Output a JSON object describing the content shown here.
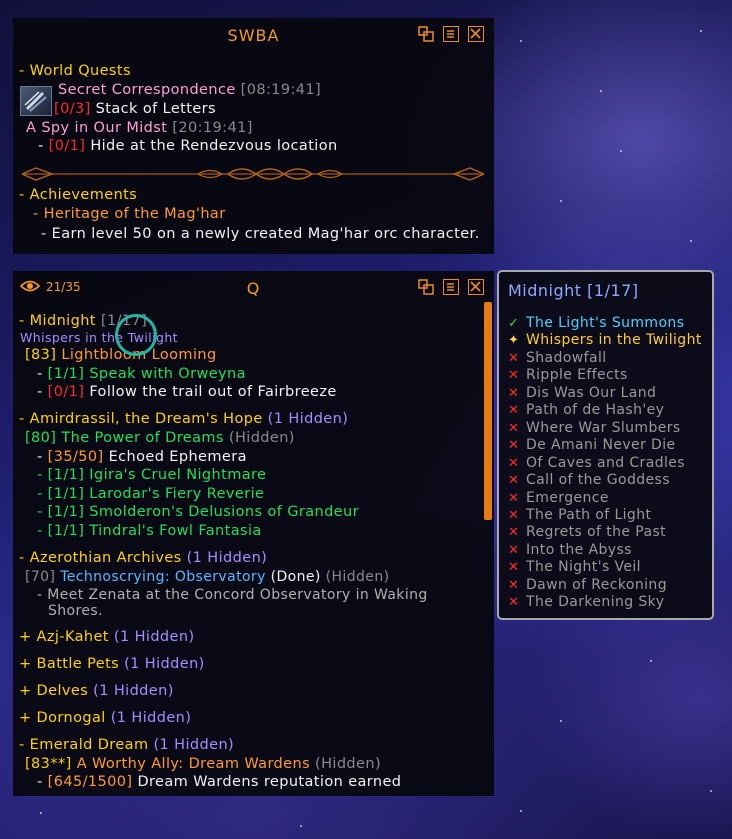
{
  "top_panel": {
    "title": "SWBA",
    "world_quests": {
      "header": "- World Quests",
      "quest1_name": "Secret Correspondence",
      "quest1_time": "[08:19:41]",
      "quest1_obj_count": "0/3]",
      "quest1_obj_open": "",
      "quest1_obj_text": "Stack of Letters",
      "quest2_name": "A Spy in Our Midst",
      "quest2_time": "[20:19:41]",
      "quest2_obj_dash": "-",
      "quest2_obj_count": "[0/1]",
      "quest2_obj_text": "Hide at the Rendezvous location"
    },
    "achievements": {
      "header": "- Achievements",
      "item": "- Heritage of the Mag'har",
      "desc": "- Earn level 50 on a newly created Mag'har orc character."
    }
  },
  "quest_panel": {
    "title": "Q",
    "count": "21/35",
    "lines": [
      {
        "name": "zone-midnight",
        "parts": [
          [
            "- Midnight",
            "y"
          ],
          [
            " [1/17]",
            "gy"
          ]
        ]
      },
      {
        "name": "campaign-label",
        "parts": [
          [
            "Whispers in the Twilight",
            "pu"
          ]
        ]
      },
      {
        "name": "quest-lightbloom",
        "parts": [
          [
            "[83] ",
            "y"
          ],
          [
            "Lightbloom Looming",
            "o"
          ]
        ]
      },
      {
        "name": "obj-speak",
        "parts": [
          [
            "- ",
            "w"
          ],
          [
            "[1/1] Speak with Orweyna",
            "g"
          ]
        ]
      },
      {
        "name": "obj-follow",
        "parts": [
          [
            "- ",
            "w"
          ],
          [
            "[0/1]",
            "r"
          ],
          [
            " Follow the trail out of Fairbreeze",
            "w"
          ]
        ]
      },
      {
        "name": "zone-amirdrassil",
        "parts": [
          [
            "- Amirdrassil, the Dream's Hope",
            "y"
          ],
          [
            " (1 Hidden)",
            "pu"
          ]
        ]
      },
      {
        "name": "quest-power-of-dreams",
        "parts": [
          [
            "[80] The Power of Dreams",
            "g"
          ],
          [
            " (Hidden)",
            "gy"
          ]
        ]
      },
      {
        "name": "obj-echoed",
        "parts": [
          [
            "- ",
            "w"
          ],
          [
            "[35/50]",
            "o"
          ],
          [
            " Echoed Ephemera",
            "w"
          ]
        ]
      },
      {
        "name": "obj-igira",
        "parts": [
          [
            "- [1/1] Igira's Cruel Nightmare",
            "g"
          ]
        ]
      },
      {
        "name": "obj-larodar",
        "parts": [
          [
            "- [1/1] Larodar's Fiery Reverie",
            "g"
          ]
        ]
      },
      {
        "name": "obj-smolderon",
        "parts": [
          [
            "- [1/1] Smolderon's Delusions of Grandeur",
            "g"
          ]
        ]
      },
      {
        "name": "obj-tindral",
        "parts": [
          [
            "- [1/1] Tindral's Fowl Fantasia",
            "g"
          ]
        ]
      },
      {
        "name": "zone-azerothian",
        "parts": [
          [
            "- Azerothian Archives",
            "y"
          ],
          [
            " (1 Hidden)",
            "pu"
          ]
        ]
      },
      {
        "name": "quest-technoscrying",
        "parts": [
          [
            "[70] ",
            "gy"
          ],
          [
            "Technoscrying: Observatory",
            "cy"
          ],
          [
            " (Done)",
            "w"
          ],
          [
            " (Hidden)",
            "gy"
          ]
        ]
      },
      {
        "name": "obj-zenata",
        "parts": [
          [
            "- Meet Zenata at the Concord Observatory in Waking",
            "lg"
          ]
        ]
      },
      {
        "name": "obj-zenata-2",
        "parts": [
          [
            "Shores.",
            "lg"
          ]
        ]
      },
      {
        "name": "zone-azj-kahet",
        "parts": [
          [
            "+ Azj-Kahet",
            "y"
          ],
          [
            " (1 Hidden)",
            "pu"
          ]
        ]
      },
      {
        "name": "zone-battle-pets",
        "parts": [
          [
            "+ Battle Pets",
            "y"
          ],
          [
            " (1 Hidden)",
            "pu"
          ]
        ]
      },
      {
        "name": "zone-delves",
        "parts": [
          [
            "+ Delves",
            "y"
          ],
          [
            " (1 Hidden)",
            "pu"
          ]
        ]
      },
      {
        "name": "zone-dornogal",
        "parts": [
          [
            "+ Dornogal",
            "y"
          ],
          [
            " (1 Hidden)",
            "pu"
          ]
        ]
      },
      {
        "name": "zone-emerald-dream",
        "parts": [
          [
            "- Emerald Dream",
            "y"
          ],
          [
            " (1 Hidden)",
            "pu"
          ]
        ]
      },
      {
        "name": "quest-worthy-ally",
        "parts": [
          [
            "[83**] ",
            "y"
          ],
          [
            "A Worthy Ally: Dream Wardens",
            "o"
          ],
          [
            " (Hidden)",
            "gy"
          ]
        ]
      },
      {
        "name": "obj-dream-wardens",
        "parts": [
          [
            "- ",
            "w"
          ],
          [
            "[645/1500]",
            "o"
          ],
          [
            " Dream Wardens reputation earned",
            "w"
          ]
        ]
      }
    ]
  },
  "tooltip": {
    "title": "Midnight [1/17]",
    "items": [
      {
        "label": "The Light's Summons",
        "state": "done"
      },
      {
        "label": "Whispers in the Twilight",
        "state": "current"
      },
      {
        "label": "Shadowfall",
        "state": "todo"
      },
      {
        "label": "Ripple Effects",
        "state": "todo"
      },
      {
        "label": "Dis Was Our Land",
        "state": "todo"
      },
      {
        "label": "Path of de Hash'ey",
        "state": "todo"
      },
      {
        "label": "Where War Slumbers",
        "state": "todo"
      },
      {
        "label": "De Amani Never Die",
        "state": "todo"
      },
      {
        "label": "Of Caves and Cradles",
        "state": "todo"
      },
      {
        "label": "Call of the Goddess",
        "state": "todo"
      },
      {
        "label": "Emergence",
        "state": "todo"
      },
      {
        "label": "The Path of Light",
        "state": "todo"
      },
      {
        "label": "Regrets of the Past",
        "state": "todo"
      },
      {
        "label": "Into the Abyss",
        "state": "todo"
      },
      {
        "label": "The Night's Veil",
        "state": "todo"
      },
      {
        "label": "Dawn of Reckoning",
        "state": "todo"
      },
      {
        "label": "The Darkening Sky",
        "state": "todo"
      }
    ]
  },
  "colors": {
    "accent_orange": "#f39a2b",
    "zone_yellow": "#ffd200",
    "complete_green": "#1fe05a",
    "incomplete_red": "#ff2a2a",
    "hidden_purple": "#a78bff"
  },
  "icons": [
    "toggle-window-icon",
    "menu-icon",
    "close-icon",
    "eye-icon",
    "quest-item-icon",
    "check-icon",
    "star-icon",
    "x-icon"
  ]
}
